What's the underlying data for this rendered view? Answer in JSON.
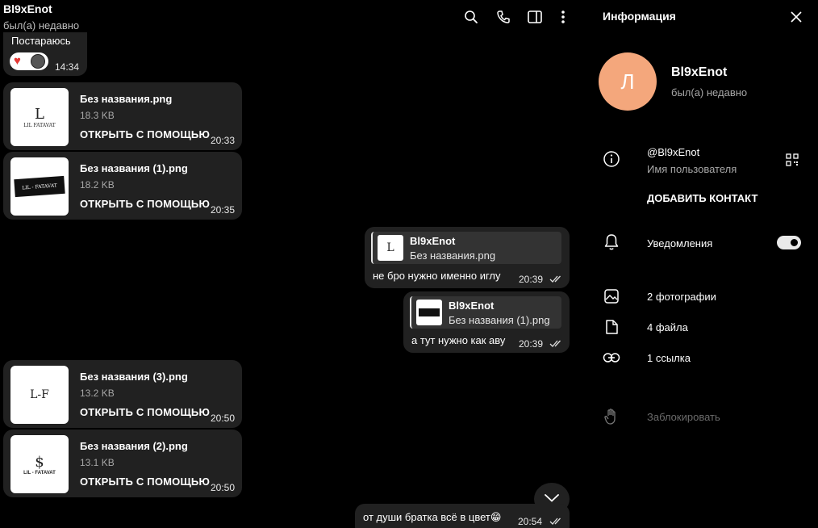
{
  "chat": {
    "title": "Bl9xEnot",
    "status": "был(а) недавно",
    "header_icons": [
      "search-icon",
      "phone-icon",
      "sidebar-toggle-icon",
      "more-vertical-icon"
    ],
    "messages": [
      {
        "type": "text_in",
        "text": "Постараюсь",
        "reactions": [
          "heart-icon",
          "reactor-avatar"
        ],
        "time": "14:34"
      },
      {
        "type": "file_in",
        "name": "Без названия.png",
        "size": "18.3 KB",
        "action": "ОТКРЫТЬ С ПОМОЩЬЮ",
        "time": "20:33",
        "thumb_text": "LIL FATAVAT"
      },
      {
        "type": "file_in",
        "name": "Без названия (1).png",
        "size": "18.2 KB",
        "action": "ОТКРЫТЬ С ПОМОЩЬЮ",
        "time": "20:35",
        "thumb_text": "LIL - FATAVAT"
      },
      {
        "type": "reply_out",
        "reply_name": "Bl9xEnot",
        "reply_text": "Без названия.png",
        "text": "не бро нужно именно иглу",
        "time": "20:39"
      },
      {
        "type": "reply_out",
        "reply_name": "Bl9xEnot",
        "reply_text": "Без названия (1).png",
        "text": "а тут нужно как аву",
        "time": "20:39"
      },
      {
        "type": "file_in",
        "name": "Без названия (3).png",
        "size": "13.2 KB",
        "action": "ОТКРЫТЬ С ПОМОЩЬЮ",
        "time": "20:50",
        "thumb_text": "L-F"
      },
      {
        "type": "file_in",
        "name": "Без названия (2).png",
        "size": "13.1 KB",
        "action": "ОТКРЫТЬ С ПОМОЩЬЮ",
        "time": "20:50",
        "thumb_text": "LIL - FATAVAT"
      },
      {
        "type": "text_out",
        "text": "от души братка всё в цвет😁",
        "time": "20:54"
      }
    ]
  },
  "info": {
    "title": "Информация",
    "avatar_letter": "Л",
    "avatar_color": "#f4a77c",
    "name": "Bl9xEnot",
    "status": "был(а) недавно",
    "username": "@Bl9xEnot",
    "username_label": "Имя пользователя",
    "add_contact": "ДОБАВИТЬ КОНТАКТ",
    "notifications": "Уведомления",
    "notifications_on": true,
    "photos": "2 фотографии",
    "files": "4 файла",
    "links": "1 ссылка",
    "block": "Заблокировать"
  },
  "colors": {
    "background": "#000000",
    "bubble": "#212121",
    "reply_box": "#333333",
    "muted": "#a7a7a7"
  }
}
